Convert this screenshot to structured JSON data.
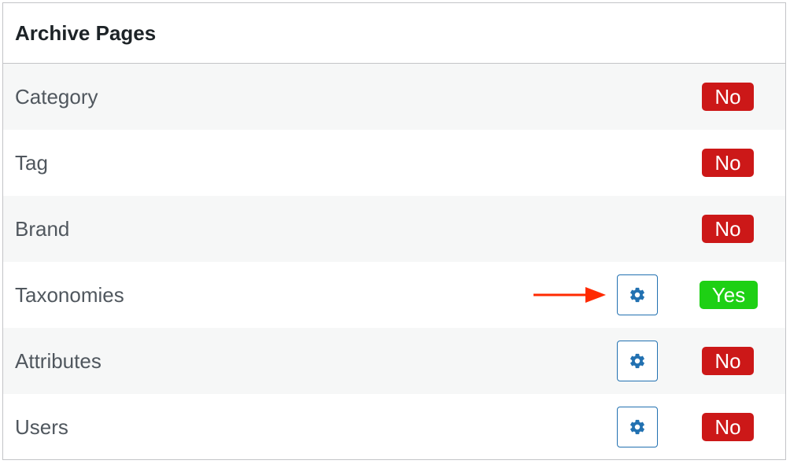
{
  "panel": {
    "title": "Archive Pages"
  },
  "rows": [
    {
      "label": "Category",
      "status": "No",
      "has_settings": false
    },
    {
      "label": "Tag",
      "status": "No",
      "has_settings": false
    },
    {
      "label": "Brand",
      "status": "No",
      "has_settings": false
    },
    {
      "label": "Taxonomies",
      "status": "Yes",
      "has_settings": true,
      "highlighted": true
    },
    {
      "label": "Attributes",
      "status": "No",
      "has_settings": true
    },
    {
      "label": "Users",
      "status": "No",
      "has_settings": true
    }
  ],
  "icons": {
    "settings": "gear-icon",
    "pointer": "arrow-right-icon"
  },
  "colors": {
    "no_badge": "#cc1818",
    "yes_badge": "#1ed014",
    "settings_accent": "#2271b1",
    "arrow": "#ff2a00"
  }
}
